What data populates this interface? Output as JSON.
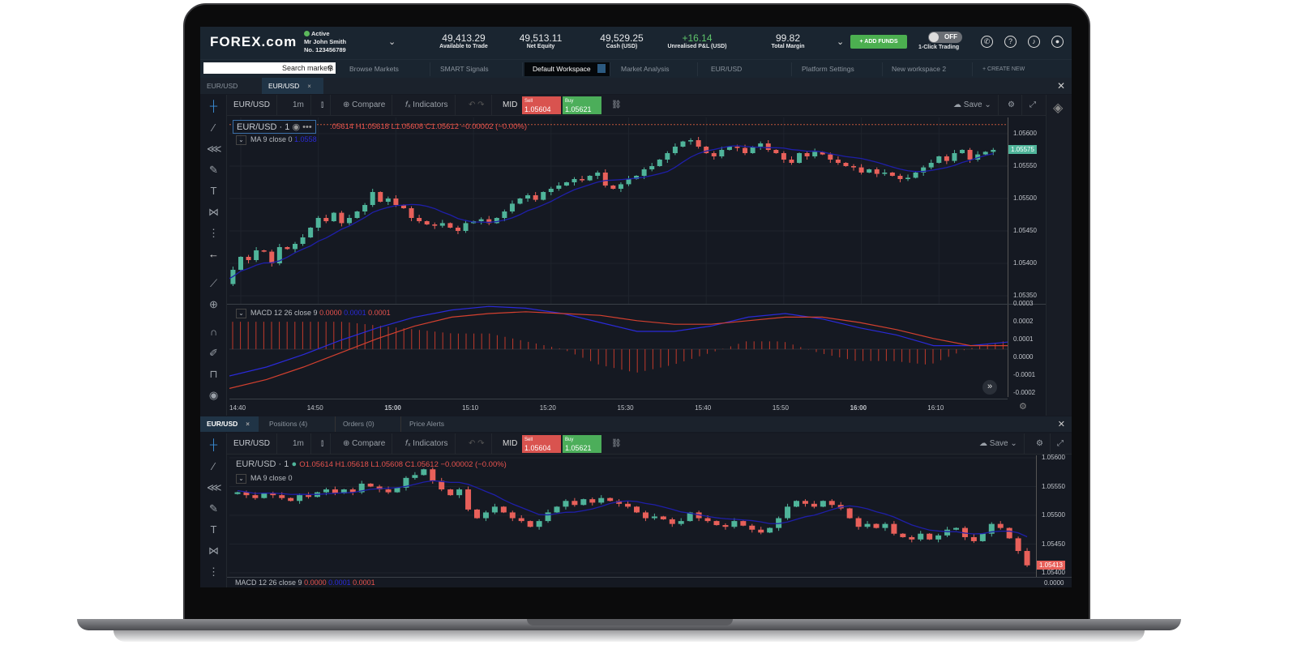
{
  "header": {
    "logo": "FOREX.com",
    "status": "Active",
    "user": "Mr John Smith",
    "account_no": "No. 123456789",
    "stats": [
      {
        "value": "49,413.29",
        "label": "Available to Trade"
      },
      {
        "value": "49,513.11",
        "label": "Net Equity"
      },
      {
        "value": "49,529.25",
        "label": "Cash (USD)"
      },
      {
        "value": "+16.14",
        "label": "Unrealised P&L (USD)"
      },
      {
        "value": "99.82",
        "label": "Total Margin"
      }
    ],
    "add_funds": "+ ADD FUNDS",
    "toggle": "OFF",
    "toggle_label": "1-Click Trading"
  },
  "workspace": {
    "search_placeholder": "Search markets",
    "tabs": [
      "Browse Markets",
      "SMART Signals",
      "Default Workspace",
      "Market Analysis",
      "EUR/USD",
      "Platform Settings",
      "New workspace 2"
    ],
    "active": "Default Workspace",
    "create": "+ CREATE NEW"
  },
  "chart_tabs": [
    "EUR/USD",
    "EUR/USD"
  ],
  "toolbar": {
    "symbol": "EUR/USD",
    "interval": "1m",
    "compare": "Compare",
    "indicators": "Indicators",
    "mid": "MID",
    "sell_label": "Sell",
    "sell": "1.05604",
    "buy_label": "Buy",
    "buy": "1.05621",
    "save": "Save"
  },
  "main_chart": {
    "title": "EUR/USD · 1",
    "ohlc": ".05614  H1.05618  L1.05608  C1.05612  −0.00002 (−0.00%)",
    "ma": "MA 9 close 0",
    "ma_value": "1.0558",
    "price_ticks": [
      "1.05600",
      "1.05550",
      "1.05500",
      "1.05450",
      "1.05400",
      "1.05350"
    ],
    "last_price": "1.05575",
    "macd": "MACD 12 26 close 9",
    "macd_values": [
      "0.0000",
      "0.0001",
      "0.0001"
    ],
    "macd_ticks": [
      "0.0003",
      "0.0002",
      "0.0001",
      "0.0000",
      "-0.0001",
      "-0.0002"
    ],
    "time_ticks": [
      "14:40",
      "14:50",
      "15:00",
      "15:10",
      "15:20",
      "15:30",
      "15:40",
      "15:50",
      "16:00",
      "16:10"
    ],
    "closes": [
      1.05372,
      1.05368,
      1.0539,
      1.0541,
      1.05405,
      1.0542,
      1.05418,
      1.054,
      1.05425,
      1.05422,
      1.0543,
      1.0544,
      1.05455,
      1.0547,
      1.05465,
      1.05478,
      1.05462,
      1.0547,
      1.0548,
      1.0549,
      1.0551,
      1.05495,
      1.055,
      1.0549,
      1.05485,
      1.0547,
      1.05465,
      1.0546,
      1.05458,
      1.05462,
      1.05455,
      1.0545,
      1.05462,
      1.05465,
      1.05468,
      1.05462,
      1.0547,
      1.0548,
      1.05492,
      1.055,
      1.05505,
      1.05498,
      1.0551,
      1.05515,
      1.0552,
      1.05525,
      1.0553,
      1.05528,
      1.05535,
      1.0554,
      1.0552,
      1.05515,
      1.05522,
      1.0553,
      1.05535,
      1.05545,
      1.0555,
      1.0556,
      1.0557,
      1.0558,
      1.05588,
      1.0559,
      1.0558,
      1.0557,
      1.05565,
      1.05575,
      1.0558,
      1.05578,
      1.0557,
      1.0558,
      1.05585,
      1.05575,
      1.0557,
      1.0556,
      1.05555,
      1.0557,
      1.05565,
      1.05572,
      1.05568,
      1.0556,
      1.05555,
      1.0555,
      1.05548,
      1.0554,
      1.05545,
      1.05538,
      1.0554,
      1.05535,
      1.0553,
      1.05532,
      1.0554,
      1.05548,
      1.05555,
      1.05565,
      1.05558,
      1.0557,
      1.05575,
      1.0556,
      1.05568,
      1.05572,
      1.05575
    ],
    "macd_line": [
      -0.00015,
      -0.0001,
      -3e-05,
      5e-05,
      0.00012,
      0.00018,
      0.00022,
      0.00024,
      0.00023,
      0.0002,
      0.00015,
      0.0001,
      0.0001,
      0.00013,
      0.00018,
      0.0002,
      0.00017,
      0.00012,
      8e-05,
      2e-05,
      2e-05,
      4e-05
    ],
    "signal_line": [
      -0.00022,
      -0.00017,
      -0.0001,
      -2e-05,
      6e-05,
      0.00013,
      0.00018,
      0.0002,
      0.00021,
      0.0002,
      0.00019,
      0.00016,
      0.00014,
      0.00014,
      0.00016,
      0.00018,
      0.00018,
      0.00015,
      0.00011,
      6e-05,
      2e-05,
      2e-05
    ]
  },
  "bottom_tabs": [
    "EUR/USD",
    "Positions (4)",
    "Orders (0)",
    "Price Alerts"
  ],
  "lower_chart": {
    "title": "EUR/USD · 1",
    "ohlc": "O1.05614  H1.05618  L1.05608  C1.05612  −0.00002 (−0.00%)",
    "ma": "MA 9 close 0",
    "price_ticks": [
      "1.05600",
      "1.05550",
      "1.05500",
      "1.05450",
      "1.05400"
    ],
    "last_price": "1.05413",
    "macd": "MACD 12 26 close 9",
    "macd_values": [
      "0.0000",
      "0.0001",
      "0.0001"
    ],
    "macd_tick": "0.0000",
    "closes": [
      1.0554,
      1.05535,
      1.0553,
      1.05538,
      1.05535,
      1.0553,
      1.05525,
      1.05535,
      1.05532,
      1.0554,
      1.05545,
      1.05538,
      1.05545,
      1.0554,
      1.05555,
      1.0555,
      1.05545,
      1.0554,
      1.05548,
      1.05565,
      1.0557,
      1.0558,
      1.0556,
      1.05545,
      1.05535,
      1.05545,
      1.0551,
      1.05495,
      1.05505,
      1.05515,
      1.05505,
      1.05495,
      1.0549,
      1.0548,
      1.0549,
      1.05505,
      1.05515,
      1.05525,
      1.05518,
      1.05528,
      1.05522,
      1.0553,
      1.05525,
      1.0552,
      1.05515,
      1.05505,
      1.05495,
      1.05498,
      1.05493,
      1.05485,
      1.0549,
      1.05505,
      1.05495,
      1.0549,
      1.05483,
      1.0548,
      1.0549,
      1.05482,
      1.05475,
      1.0547,
      1.05478,
      1.05495,
      1.05515,
      1.05525,
      1.0552,
      1.05515,
      1.05525,
      1.05518,
      1.05512,
      1.05495,
      1.0548,
      1.05485,
      1.05478,
      1.05485,
      1.05468,
      1.05462,
      1.05458,
      1.05468,
      1.05458,
      1.05465,
      1.05475,
      1.05478,
      1.05462,
      1.05455,
      1.05468,
      1.05485,
      1.05478,
      1.0546,
      1.05438,
      1.05413
    ]
  },
  "colors": {
    "up": "#4fb49a",
    "down": "#e8605a",
    "ma": "#1f1fa8",
    "macd": "#2a2ad8",
    "signal": "#d3402f",
    "accent": "#4caf50"
  }
}
